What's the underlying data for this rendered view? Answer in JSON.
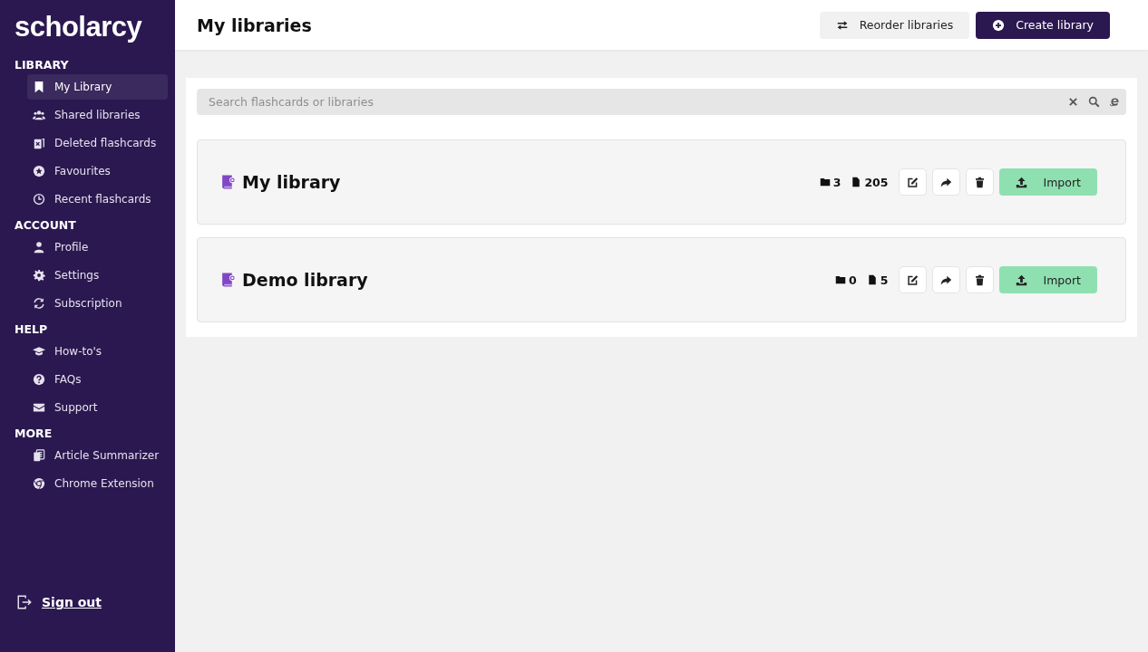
{
  "sidebar": {
    "logo": "scholarcy",
    "sections": [
      {
        "title": "LIBRARY",
        "items": [
          {
            "label": "My Library",
            "selected": true
          },
          {
            "label": "Shared libraries",
            "selected": false
          },
          {
            "label": "Deleted flashcards",
            "selected": false
          },
          {
            "label": "Favourites",
            "selected": false
          },
          {
            "label": "Recent flashcards",
            "selected": false
          }
        ]
      },
      {
        "title": "ACCOUNT",
        "items": [
          {
            "label": "Profile",
            "selected": false
          },
          {
            "label": "Settings",
            "selected": false
          },
          {
            "label": "Subscription",
            "selected": false
          }
        ]
      },
      {
        "title": "HELP",
        "items": [
          {
            "label": "How-to's",
            "selected": false
          },
          {
            "label": "FAQs",
            "selected": false
          },
          {
            "label": "Support",
            "selected": false
          }
        ]
      },
      {
        "title": "MORE",
        "items": [
          {
            "label": "Article Summarizer",
            "selected": false
          },
          {
            "label": "Chrome Extension",
            "selected": false
          }
        ]
      }
    ],
    "sign_out": "Sign out"
  },
  "header": {
    "title": "My libraries",
    "buttons": [
      {
        "label": "Reorder libraries",
        "kind": "secondary"
      },
      {
        "label": "Create library",
        "kind": "primary"
      }
    ]
  },
  "search": {
    "placeholder": "Search flashcards or libraries"
  },
  "libraries": [
    {
      "name": "My library",
      "folders": "3",
      "cards": "205",
      "import": "Import"
    },
    {
      "name": "Demo library",
      "folders": "0",
      "cards": "5",
      "import": "Import"
    }
  ]
}
